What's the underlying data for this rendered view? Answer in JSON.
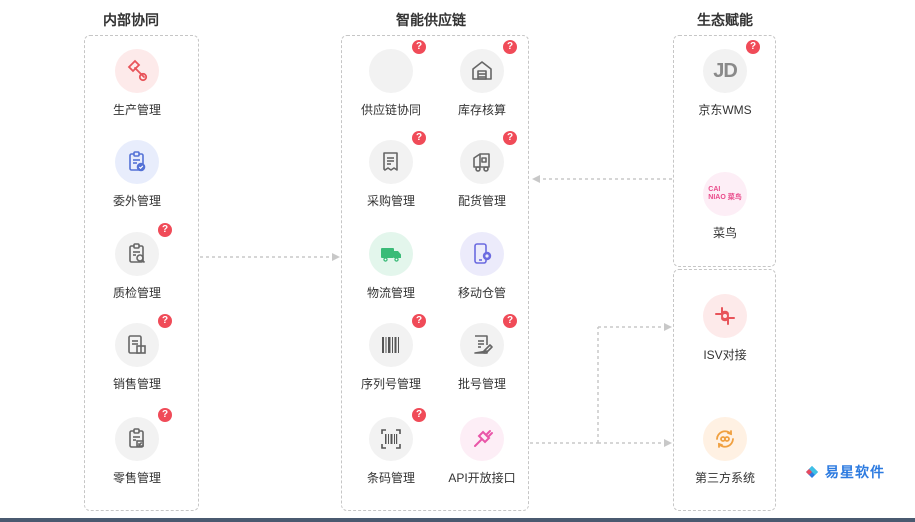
{
  "columns": {
    "internal": "内部协同",
    "supply_chain": "智能供应链",
    "ecosystem": "生态赋能"
  },
  "internal_modules": [
    {
      "label": "生产管理",
      "help": false
    },
    {
      "label": "委外管理",
      "help": false
    },
    {
      "label": "质检管理",
      "help": true
    },
    {
      "label": "销售管理",
      "help": true
    },
    {
      "label": "零售管理",
      "help": true
    }
  ],
  "supply_modules": [
    {
      "label": "供应链协同",
      "help": true
    },
    {
      "label": "库存核算",
      "help": true
    },
    {
      "label": "采购管理",
      "help": true
    },
    {
      "label": "配货管理",
      "help": true
    },
    {
      "label": "物流管理",
      "help": false
    },
    {
      "label": "移动仓管",
      "help": false
    },
    {
      "label": "序列号管理",
      "help": true
    },
    {
      "label": "批号管理",
      "help": true
    },
    {
      "label": "条码管理",
      "help": true
    },
    {
      "label": "API开放接口",
      "help": false
    }
  ],
  "eco_top": [
    {
      "label": "京东WMS",
      "help": true,
      "logo": "JD"
    },
    {
      "label": "菜鸟",
      "help": false,
      "logo_line1": "CAI",
      "logo_line2": "NIAO 菜鸟"
    }
  ],
  "eco_bottom": [
    {
      "label": "ISV对接",
      "help": false
    },
    {
      "label": "第三方系统",
      "help": false
    }
  ],
  "help_symbol": "?",
  "brand": {
    "name": "易星软件"
  },
  "icons": {
    "production": "hammer-gear-icon",
    "outsourcing": "clipboard-check-icon",
    "quality": "clipboard-search-icon",
    "sales": "document-box-icon",
    "retail": "receipt-check-icon",
    "supply_collab": "blank-icon",
    "inventory": "warehouse-icon",
    "purchase": "receipt-icon",
    "distribution": "delivery-icon",
    "logistics": "truck-icon",
    "mobile_warehouse": "phone-gear-icon",
    "serial": "barcode-icon",
    "batch": "edit-document-icon",
    "barcode": "scan-icon",
    "api": "plug-icon",
    "isv": "connector-icon",
    "third_party": "sync-link-icon"
  },
  "colors": {
    "accent_red": "#f04b58",
    "dashed_border": "#c6c6c6",
    "brand_blue": "#2d7be0"
  }
}
